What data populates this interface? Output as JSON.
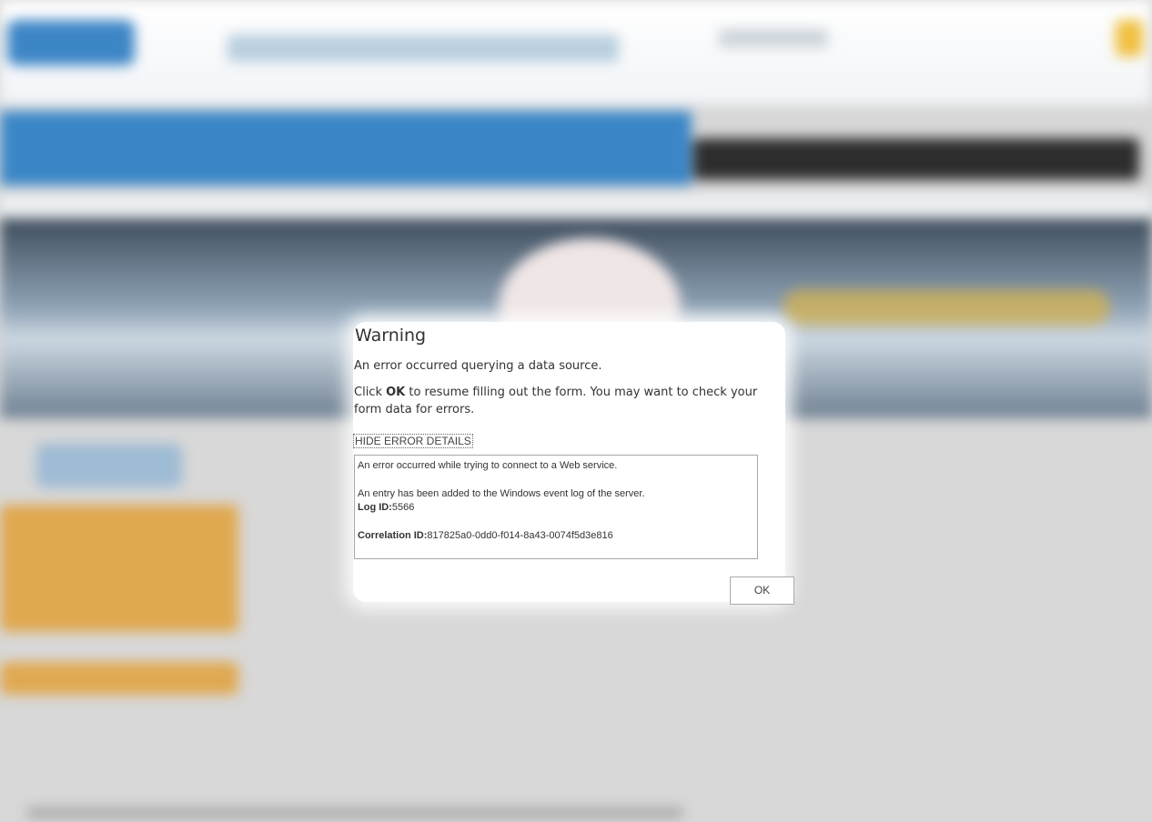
{
  "dialog": {
    "title": "Warning",
    "message": "An error occurred querying a data source.",
    "instructions": {
      "prefix": "Click ",
      "emphasis": "OK",
      "suffix": " to resume filling out the form. You may want to check your form data for errors."
    },
    "toggle_details_label": "HIDE ERROR DETAILS",
    "details": {
      "line1": "An error occurred while trying to connect to a Web service.",
      "line2": "An entry has been added to the Windows event log of the server.",
      "log_id_label": "Log ID:",
      "log_id_value": "5566",
      "correlation_id_label": "Correlation ID:",
      "correlation_id_value": "817825a0-0dd0-f014-8a43-0074f5d3e816"
    },
    "ok_label": "OK"
  },
  "colors": {
    "nav_blue": "#3a86c7",
    "accent_orange": "#e0a850",
    "dialog_background": "#ffffff",
    "text": "#333333"
  }
}
